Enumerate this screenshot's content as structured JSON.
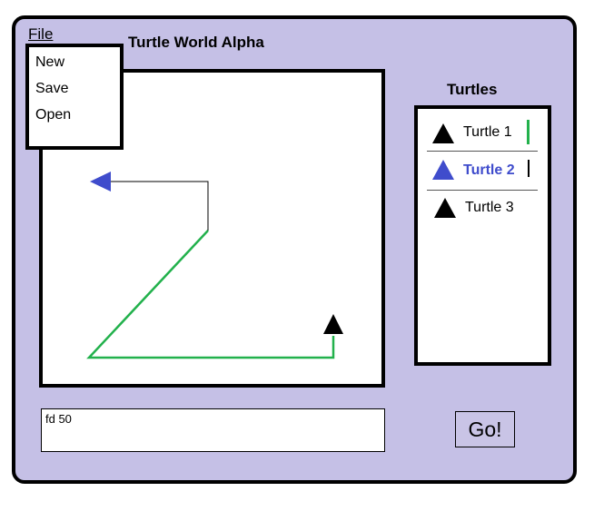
{
  "menu": {
    "file_label": "File",
    "items": [
      {
        "label": "New"
      },
      {
        "label": "Save"
      },
      {
        "label": "Open"
      }
    ]
  },
  "app": {
    "title": "Turtle World Alpha"
  },
  "turtles_panel": {
    "heading": "Turtles",
    "items": [
      {
        "label": "Turtle 1",
        "color": "#000000",
        "pen_color": "#22b14c",
        "selected": false
      },
      {
        "label": "Turtle 2",
        "color": "#3f4ccc",
        "pen_color": "#000000",
        "selected": true
      },
      {
        "label": "Turtle 3",
        "color": "#000000",
        "pen_color": null,
        "selected": false
      }
    ]
  },
  "command": {
    "value": "fd 50"
  },
  "go_button": {
    "label": "Go!"
  },
  "colors": {
    "window_bg": "#c5c0e6",
    "green_trail": "#22b14c",
    "selected_turtle": "#3f4ccc",
    "black": "#000000"
  }
}
